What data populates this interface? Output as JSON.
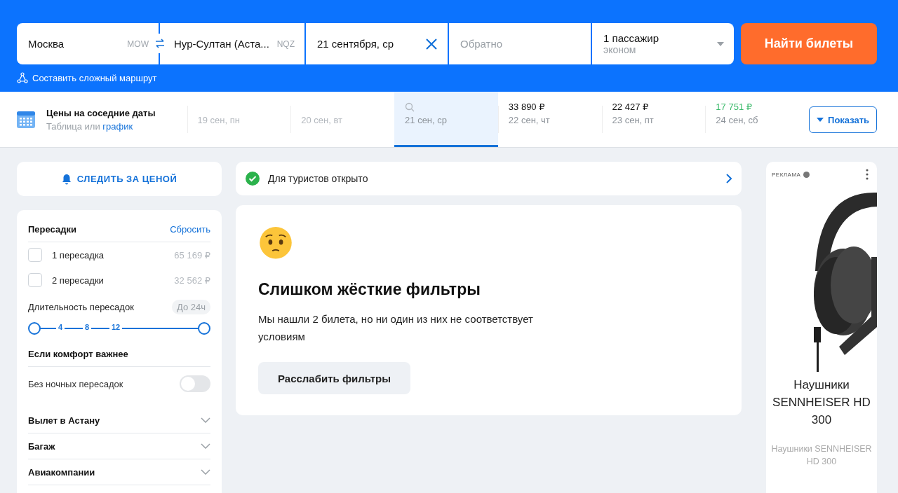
{
  "search": {
    "origin": {
      "value": "Москва",
      "code": "MOW"
    },
    "destination": {
      "value": "Нур-Султан (Аста...",
      "code": "NQZ"
    },
    "depart": {
      "value": "21 сентября, ср"
    },
    "return": {
      "placeholder": "Обратно"
    },
    "passengers": {
      "count": "1 пассажир",
      "class": "эконом"
    },
    "submit": "Найти билеты",
    "complex_route": "Составить сложный маршрут"
  },
  "dates": {
    "title": "Цены на соседние даты",
    "subtitle": "Таблица или",
    "subtitle_link": "график",
    "cells": [
      {
        "date": "19 сен, пн",
        "selected": false,
        "available": false
      },
      {
        "date": "20 сен, вт",
        "selected": false,
        "available": false
      },
      {
        "date": "21 сен, ср",
        "selected": true,
        "available": false
      },
      {
        "price": "33 890 ₽",
        "date": "22 сен, чт",
        "selected": false,
        "cheapest": false,
        "available": true
      },
      {
        "price": "22 427 ₽",
        "date": "23 сен, пт",
        "selected": false,
        "cheapest": false,
        "available": true
      },
      {
        "price": "17 751 ₽",
        "date": "24 сен, сб",
        "selected": false,
        "cheapest": true,
        "available": true
      }
    ],
    "show_button": "Показать"
  },
  "follow_price": "СЛЕДИТЬ ЗА ЦЕНОЙ",
  "filters": {
    "stops_title": "Пересадки",
    "reset": "Сбросить",
    "stops": [
      {
        "label": "1 пересадка",
        "price": "65 169 ₽",
        "checked": false
      },
      {
        "label": "2 пересадки",
        "price": "32 562 ₽",
        "checked": false
      }
    ],
    "duration": {
      "title": "Длительность пересадок",
      "badge": "До 24ч",
      "ticks": [
        "4",
        "8",
        "12"
      ],
      "level": 1
    },
    "comfort_title": "Если комфорт важнее",
    "night": {
      "label": "Без ночных пересадок",
      "on": false
    },
    "sections": [
      {
        "label": "Вылет в Астану",
        "expanded": false
      },
      {
        "label": "Багаж",
        "expanded": false
      },
      {
        "label": "Авиакомпании",
        "expanded": false
      }
    ]
  },
  "notice": {
    "text": "Для туристов открыто"
  },
  "empty": {
    "title": "Слишком жёсткие фильтры",
    "message": "Мы нашли 2 билета, но ни один из них не соответствует условиям",
    "button": "Расслабить фильтры"
  },
  "ad": {
    "label": "РЕКЛАМА",
    "title": "Наушники SENNHEISER HD 300",
    "caption": "Наушники SENNHEISER HD 300"
  }
}
